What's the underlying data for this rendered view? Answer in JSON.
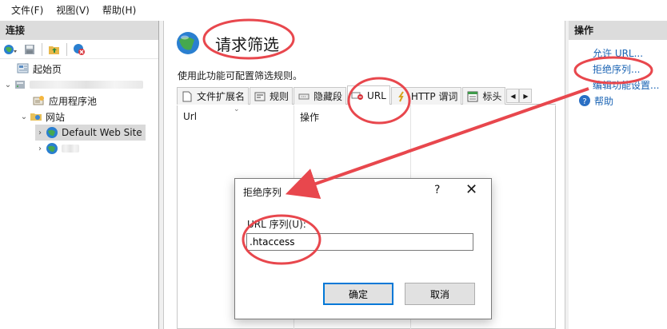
{
  "menu": {
    "items": [
      {
        "label": "文件(F)"
      },
      {
        "label": "视图(V)"
      },
      {
        "label": "帮助(H)"
      }
    ]
  },
  "connections": {
    "header": "连接",
    "tree": {
      "start_page": "起始页",
      "app_pools": "应用程序池",
      "sites": "网站",
      "default_site": "Default Web Site"
    }
  },
  "main": {
    "title": "请求筛选",
    "description": "使用此功能可配置筛选规则。",
    "tabs": [
      {
        "label": "文件扩展名",
        "icon": "file-icon"
      },
      {
        "label": "规则",
        "icon": "rules-icon"
      },
      {
        "label": "隐藏段",
        "icon": "hidden-segment-icon"
      },
      {
        "label": "URL",
        "icon": "url-deny-icon"
      },
      {
        "label": "HTTP 谓词",
        "icon": "verb-icon"
      },
      {
        "label": "标头",
        "icon": "header-icon"
      }
    ],
    "columns": [
      "Url",
      "操作"
    ]
  },
  "actions_panel": {
    "header": "操作",
    "items": [
      {
        "label": "允许 URL..."
      },
      {
        "label": "拒绝序列..."
      },
      {
        "label": "编辑功能设置..."
      },
      {
        "label": "帮助",
        "icon": "help-icon"
      }
    ]
  },
  "dialog": {
    "title": "拒绝序列",
    "help": "?",
    "close": "✕",
    "field_label": "URL 序列(U):",
    "field_value": ".htaccess",
    "ok_label": "确定",
    "cancel_label": "取消"
  },
  "colors": {
    "link": "#1b64b4",
    "annotation": "#e8474d",
    "header_bg": "#dcdcdc",
    "focus": "#0078d7"
  }
}
